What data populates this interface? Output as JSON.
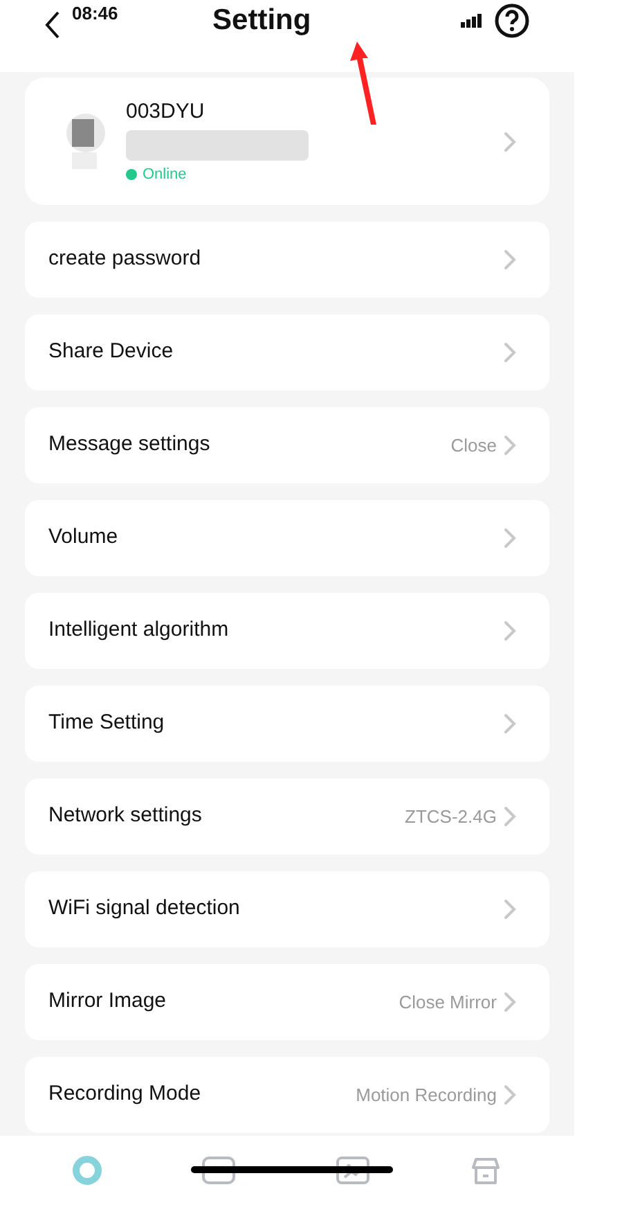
{
  "status_bar": {
    "time": "08:46"
  },
  "header": {
    "title": "Setting"
  },
  "device": {
    "name": "003DYU",
    "status": "Online",
    "online": true
  },
  "settings": [
    {
      "label": "create password"
    },
    {
      "label": "Share Device"
    },
    {
      "label": "Message settings",
      "value": "Close"
    },
    {
      "label": "Volume"
    },
    {
      "label": "Intelligent algorithm"
    },
    {
      "label": "Time Setting"
    },
    {
      "label": "Network settings",
      "value": "ZTCS-2.4G"
    },
    {
      "label": "WiFi signal detection"
    },
    {
      "label": "Mirror Image",
      "value": "Close Mirror"
    },
    {
      "label": "Recording Mode",
      "value": "Motion Recording"
    }
  ],
  "tab_bar": [
    {
      "kind": "home",
      "selected": true
    },
    {
      "kind": "chat",
      "selected": false
    },
    {
      "kind": "gallery",
      "selected": false
    },
    {
      "kind": "store",
      "selected": false
    }
  ]
}
